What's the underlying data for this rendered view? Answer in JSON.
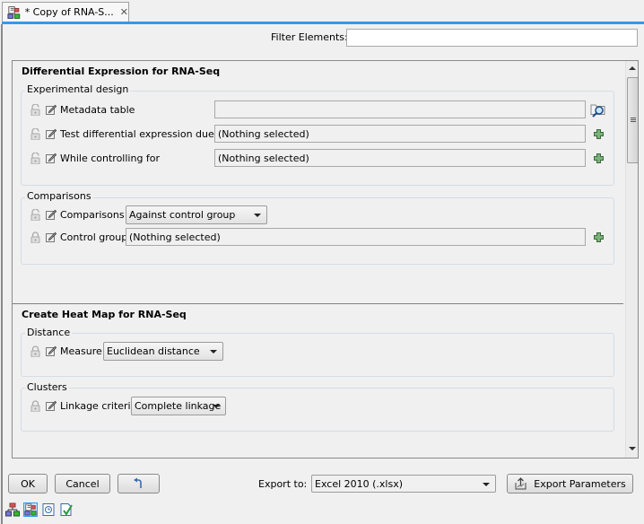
{
  "tab": {
    "title": "* Copy of RNA-S...",
    "icon": "workflow-doc-icon",
    "close_icon": "close-icon"
  },
  "filter": {
    "label": "Filter Elements:",
    "value": "",
    "placeholder": ""
  },
  "sections": [
    {
      "title": "Differential Expression for RNA-Seq",
      "groups": [
        {
          "title": "Experimental design",
          "rows": [
            {
              "label": "Metadata table",
              "value": "",
              "locked": false,
              "action_icon": "browse-folder-icon"
            },
            {
              "label": "Test differential expression due to",
              "value": "(Nothing selected)",
              "locked": false,
              "action_icon": "add-plus-icon"
            },
            {
              "label": "While controlling for",
              "value": "(Nothing selected)",
              "locked": false,
              "action_icon": "add-plus-icon"
            }
          ]
        },
        {
          "title": "Comparisons",
          "rows": [
            {
              "label": "Comparisons",
              "value": "Against control group",
              "type": "dropdown",
              "locked": false
            },
            {
              "label": "Control group",
              "value": "(Nothing selected)",
              "locked": true,
              "action_icon": "add-plus-icon"
            }
          ]
        }
      ]
    },
    {
      "title": "Create Heat Map for RNA-Seq",
      "groups": [
        {
          "title": "Distance",
          "rows": [
            {
              "label": "Measure",
              "value": "Euclidean distance",
              "type": "dropdown",
              "locked": true
            }
          ]
        },
        {
          "title": "Clusters",
          "rows": [
            {
              "label": "Linkage criteria",
              "value": "Complete linkage",
              "type": "dropdown",
              "locked": true
            }
          ]
        }
      ]
    }
  ],
  "footer": {
    "ok_label": "OK",
    "cancel_label": "Cancel",
    "reset_icon": "undo-arrow-icon",
    "export_to_label": "Export to:",
    "export_format": "Excel 2010 (.xlsx)",
    "export_params_label": "Export Parameters"
  },
  "view_icons": [
    {
      "name": "workflow-view-icon",
      "active": false
    },
    {
      "name": "parameters-view-icon",
      "active": true
    },
    {
      "name": "history-view-icon",
      "active": false
    },
    {
      "name": "validation-view-icon",
      "active": false
    }
  ],
  "colors": {
    "accent": "#3399ee",
    "plus_green": "#5a8a56",
    "background": "#f0f0f0"
  }
}
